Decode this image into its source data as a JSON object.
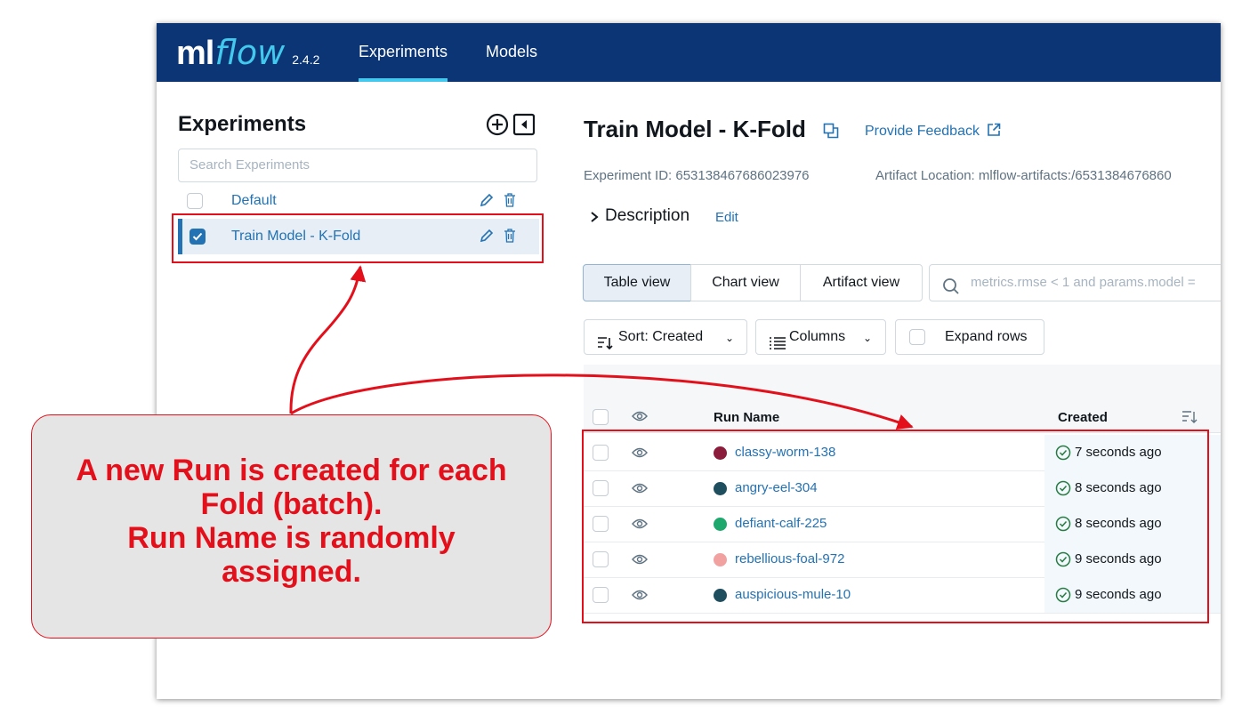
{
  "app": {
    "logo_ml": "ml",
    "logo_flow": "flow",
    "version": "2.4.2",
    "nav": [
      {
        "label": "Experiments",
        "active": true
      },
      {
        "label": "Models",
        "active": false
      }
    ]
  },
  "sidebar": {
    "title": "Experiments",
    "search_placeholder": "Search Experiments",
    "items": [
      {
        "label": "Default",
        "selected": false
      },
      {
        "label": "Train Model - K-Fold",
        "selected": true
      }
    ]
  },
  "main": {
    "title": "Train Model - K-Fold",
    "feedback_label": "Provide Feedback",
    "experiment_id": "Experiment ID: 653138467686023976",
    "artifact_location": "Artifact Location: mlflow-artifacts:/6531384676860",
    "description_label": "Description",
    "description_edit": "Edit",
    "tabs": [
      {
        "label": "Table view",
        "active": true
      },
      {
        "label": "Chart view",
        "active": false
      },
      {
        "label": "Artifact view",
        "active": false
      }
    ],
    "search_placeholder": "metrics.rmse < 1 and params.model =",
    "sort_label": "Sort: Created",
    "columns_label": "Columns",
    "expand_rows_label": "Expand rows"
  },
  "table": {
    "headers": {
      "run_name": "Run Name",
      "created": "Created"
    },
    "rows": [
      {
        "name": "classy-worm-138",
        "color": "#8c1c3b",
        "created": "7 seconds ago"
      },
      {
        "name": "angry-eel-304",
        "color": "#1f4e5f",
        "created": "8 seconds ago"
      },
      {
        "name": "defiant-calf-225",
        "color": "#1ea86e",
        "created": "8 seconds ago"
      },
      {
        "name": "rebellious-foal-972",
        "color": "#f2a1a1",
        "created": "9 seconds ago"
      },
      {
        "name": "auspicious-mule-10",
        "color": "#1f4e5f",
        "created": "9 seconds ago"
      }
    ]
  },
  "annotation": {
    "lines": [
      "A new Run is created for each",
      "Fold (batch).",
      "Run Name is randomly",
      "assigned."
    ]
  },
  "colors": {
    "header_bg": "#0b3574",
    "accent": "#43c9ed",
    "link": "#2272b4",
    "annotation_red": "#e3101b"
  }
}
